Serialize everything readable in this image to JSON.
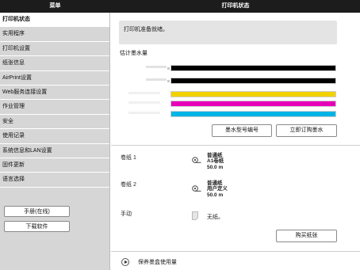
{
  "header": {
    "menu_title": "菜单",
    "page_title": "打印机状态"
  },
  "sidebar": {
    "items": [
      {
        "label": "打印机状态",
        "active": true
      },
      {
        "label": "实用程序"
      },
      {
        "label": "打印机设置"
      },
      {
        "label": "纸张信息"
      },
      {
        "label": "AirPrint设置"
      },
      {
        "label": "Web服务连接设置"
      },
      {
        "label": "作业管理"
      },
      {
        "label": "安全"
      },
      {
        "label": "使用记录"
      },
      {
        "label": "系统信息和LAN设置"
      },
      {
        "label": "固件更新"
      },
      {
        "label": "语言选择"
      }
    ],
    "manual_button": "手册(在线)",
    "download_button": "下载软件"
  },
  "main": {
    "status_message": "打印机准备就绪。",
    "ink_section_title": "估计墨水量",
    "inks": [
      {
        "color": "#000000",
        "level": 1.0
      },
      {
        "color": "#000000",
        "level": 1.0
      },
      {
        "color": "#f2d100",
        "level": 1.0
      },
      {
        "color": "#e600b8",
        "level": 1.0
      },
      {
        "color": "#00b4e6",
        "level": 1.0
      }
    ],
    "ink_model_button": "墨水型号编号",
    "order_ink_button": "立即订购墨水",
    "sources": [
      {
        "label": "卷纸 1",
        "icon": "paper-roll-icon",
        "lines": [
          "普通纸",
          "A1卷纸",
          "50.0 m"
        ]
      },
      {
        "label": "卷纸 2",
        "icon": "paper-roll-icon",
        "lines": [
          "普通纸",
          "用户定义",
          "50.0 m"
        ]
      },
      {
        "label": "手动",
        "icon": "paper-sheet-icon",
        "lines": [
          "无纸。"
        ]
      }
    ],
    "buy_paper_button": "购买纸张",
    "maintenance_link": "保养墨盒使用量"
  }
}
